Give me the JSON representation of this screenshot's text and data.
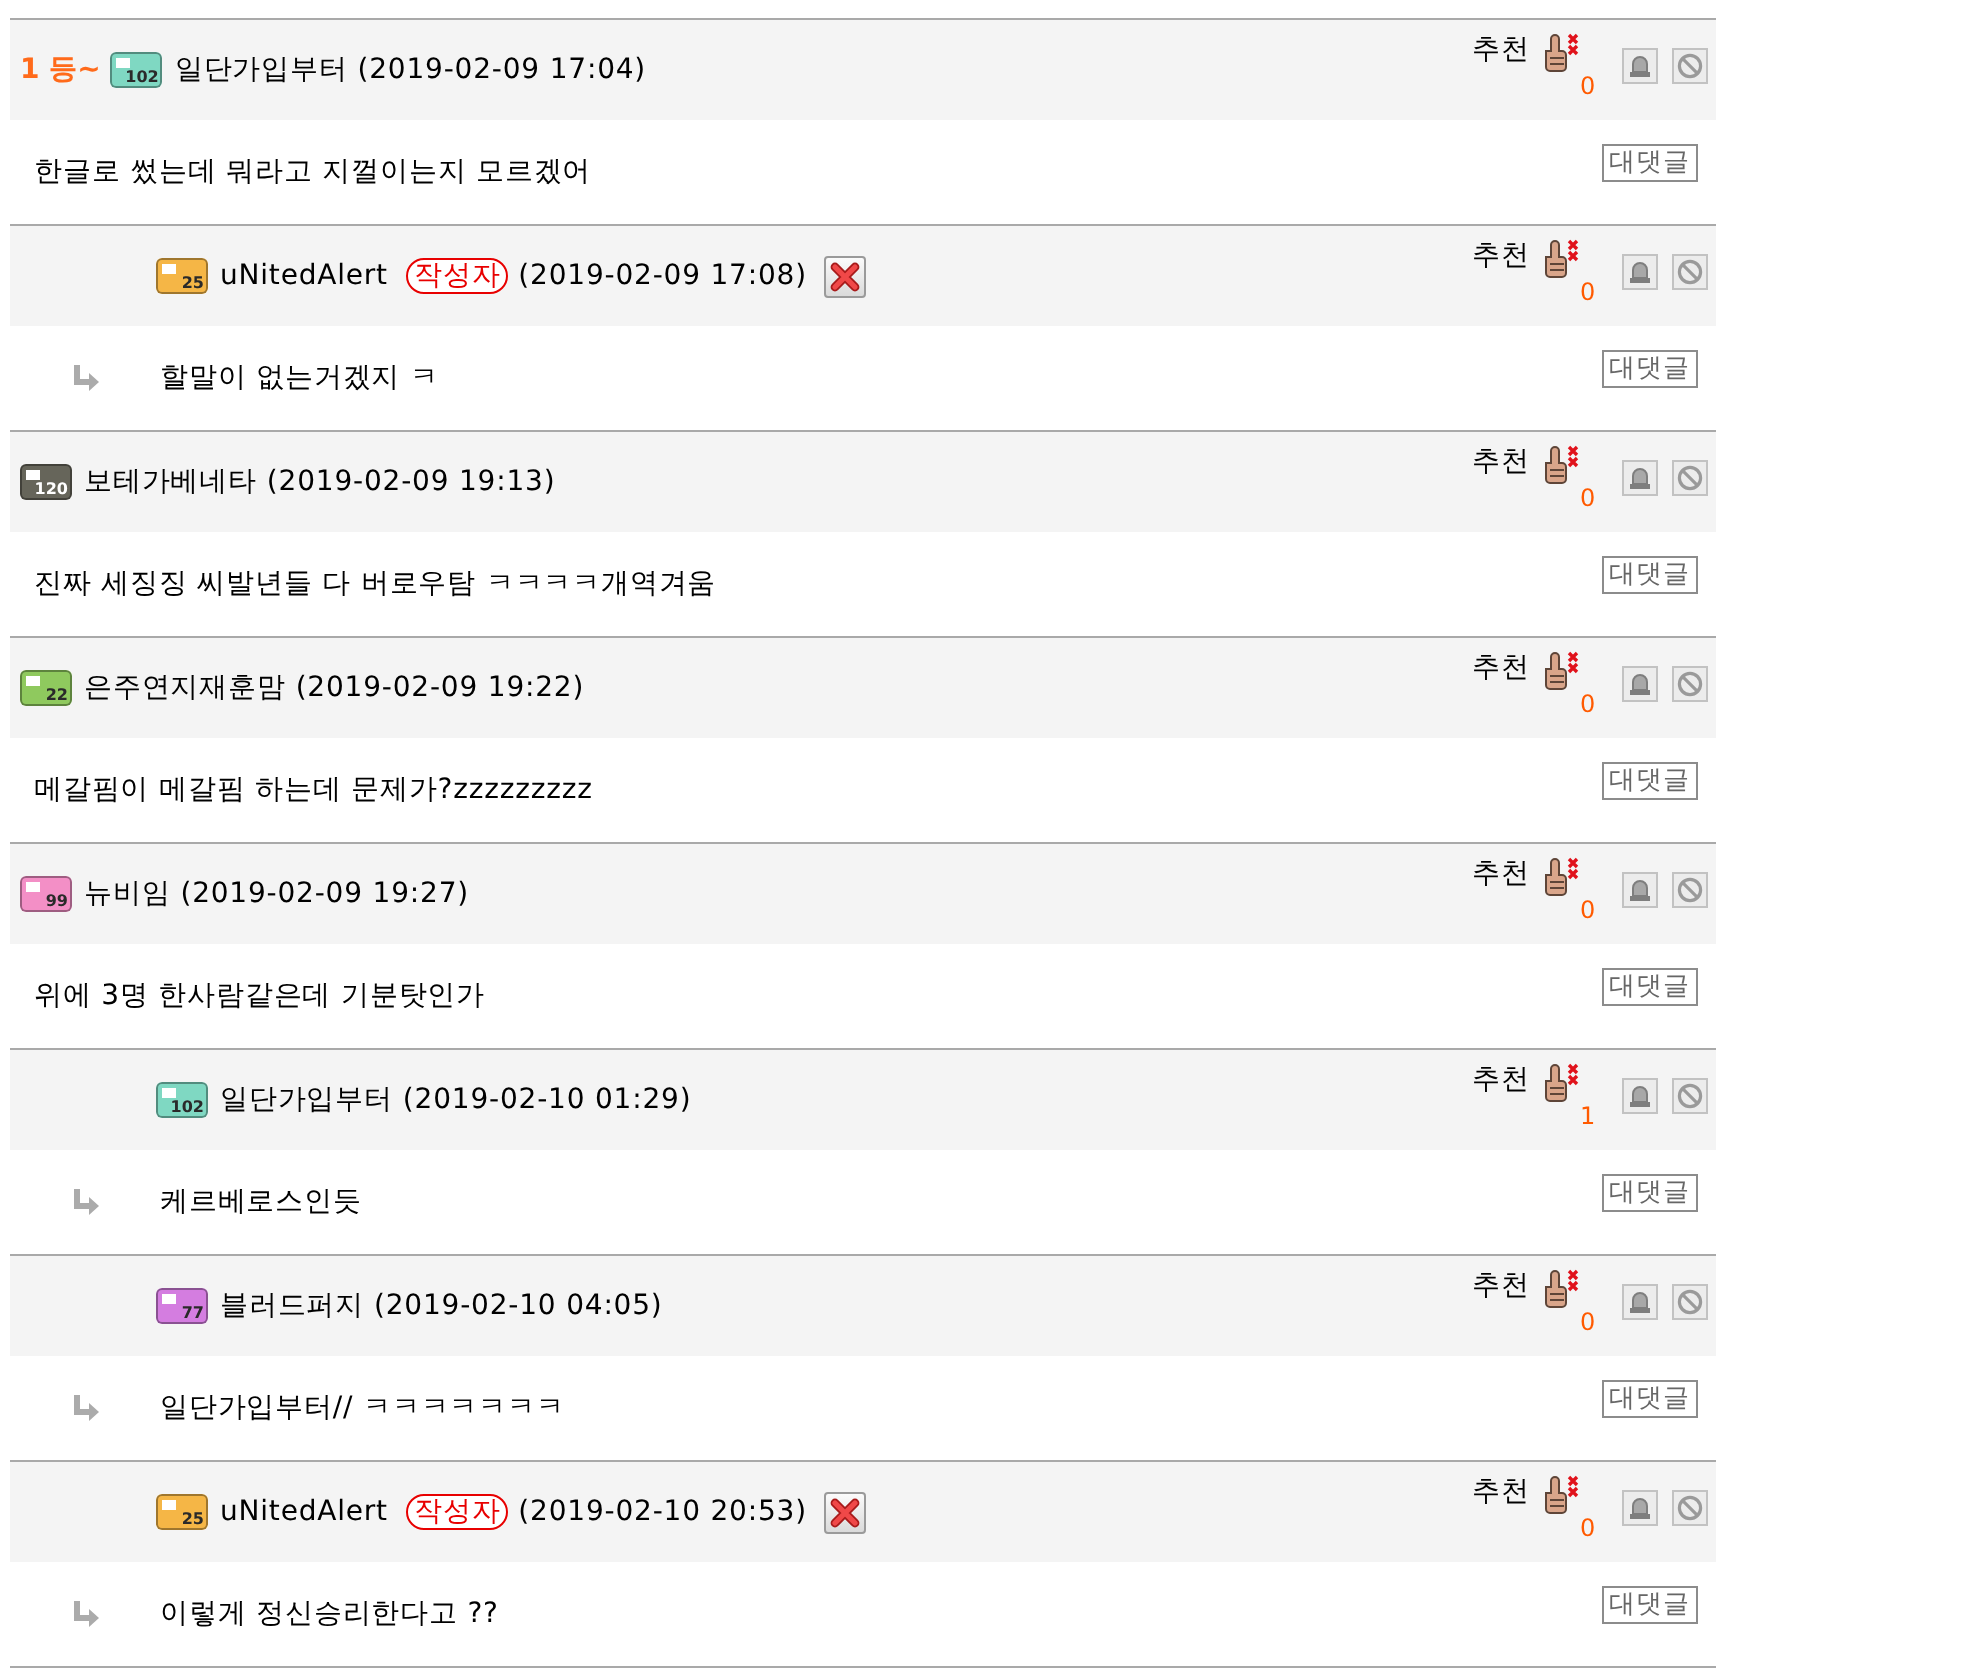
{
  "comments": [
    {
      "reply": false,
      "rank": "1 등~",
      "badge": {
        "level": "102",
        "color": "#7fd8c2"
      },
      "author": "일단가입부터",
      "time": "(2019-02-09 17:04)",
      "deletable": false,
      "recommend": {
        "label": "추천",
        "count": "0"
      },
      "text": "한글로 썼는데 뭐라고 지껄이는지 모르겠어",
      "reply_button": "대댓글"
    },
    {
      "reply": true,
      "badge": {
        "level": "25",
        "color": "#f5b646"
      },
      "author": "uNitedAlert",
      "writer_tag": "작성자",
      "time": "(2019-02-09 17:08)",
      "deletable": true,
      "recommend": {
        "label": "추천",
        "count": "0"
      },
      "text": "할말이 없는거겠지 ㅋ",
      "reply_button": "대댓글"
    },
    {
      "reply": false,
      "badge": {
        "level": "120",
        "color": "#66655a"
      },
      "author": "보테가베네타",
      "time": "(2019-02-09 19:13)",
      "deletable": false,
      "recommend": {
        "label": "추천",
        "count": "0"
      },
      "text": "진짜 세징징 씨발년들 다 버로우탐 ㅋㅋㅋㅋ개역겨움",
      "reply_button": "대댓글"
    },
    {
      "reply": false,
      "badge": {
        "level": "22",
        "color": "#8fc95e"
      },
      "author": "은주연지재훈맘",
      "time": "(2019-02-09 19:22)",
      "deletable": false,
      "recommend": {
        "label": "추천",
        "count": "0"
      },
      "text": "메갈핌이 메갈핌 하는데 문제가?zzzzzzzzz",
      "reply_button": "대댓글"
    },
    {
      "reply": false,
      "badge": {
        "level": "99",
        "color": "#f38fc6"
      },
      "author": "뉴비임",
      "time": "(2019-02-09 19:27)",
      "deletable": false,
      "recommend": {
        "label": "추천",
        "count": "0"
      },
      "text": "위에 3명 한사람같은데 기분탓인가",
      "reply_button": "대댓글"
    },
    {
      "reply": true,
      "badge": {
        "level": "102",
        "color": "#7fd8c2"
      },
      "author": "일단가입부터",
      "time": "(2019-02-10 01:29)",
      "deletable": false,
      "recommend": {
        "label": "추천",
        "count": "1"
      },
      "text": "케르베로스인듯",
      "reply_button": "대댓글"
    },
    {
      "reply": true,
      "badge": {
        "level": "77",
        "color": "#d47de0"
      },
      "author": "블러드퍼지",
      "time": "(2019-02-10 04:05)",
      "deletable": false,
      "recommend": {
        "label": "추천",
        "count": "0"
      },
      "text": "일단가입부터// ㅋㅋㅋㅋㅋㅋㅋ",
      "reply_button": "대댓글"
    },
    {
      "reply": true,
      "badge": {
        "level": "25",
        "color": "#f5b646"
      },
      "author": "uNitedAlert",
      "writer_tag": "작성자",
      "time": "(2019-02-10 20:53)",
      "deletable": true,
      "recommend": {
        "label": "추천",
        "count": "0"
      },
      "text": "이렇게 정신승리한다고 ??",
      "reply_button": "대댓글"
    }
  ]
}
